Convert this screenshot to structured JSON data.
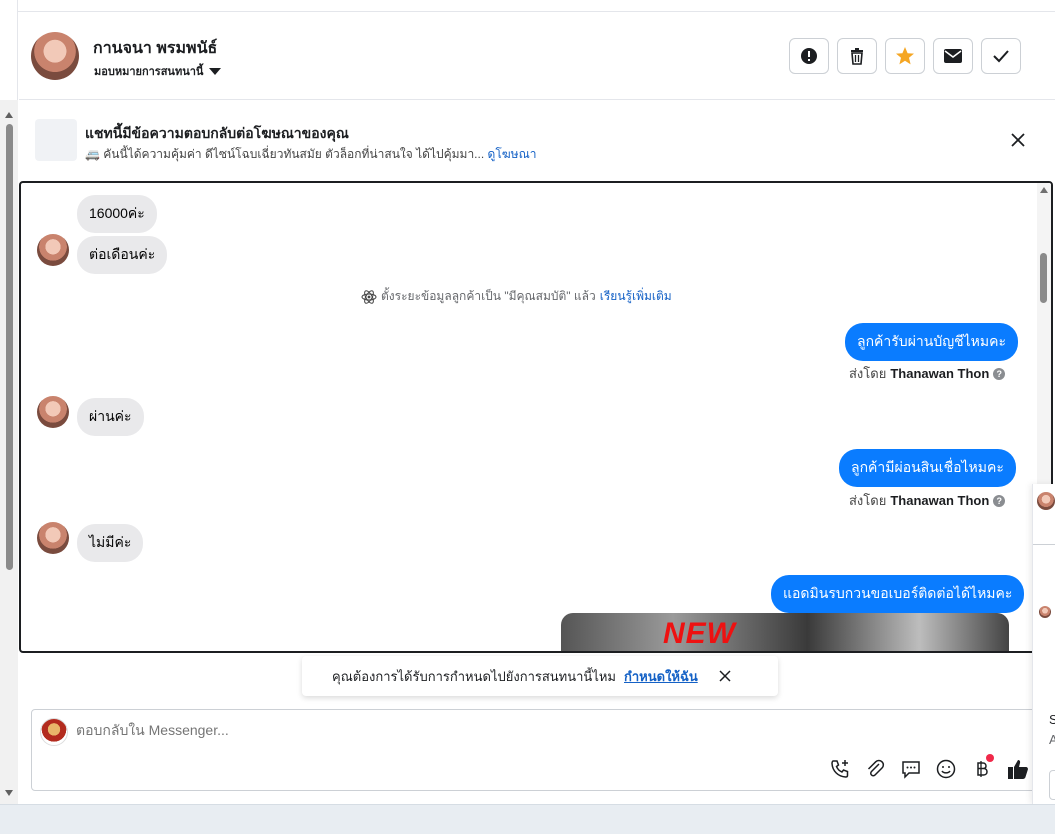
{
  "header": {
    "contact_name": "กานจนา พรมพนัธ์",
    "assign_label": "มอบหมายการสนทนานี้",
    "actions": [
      "spam-button",
      "delete-button",
      "star-button",
      "unread-button",
      "done-button"
    ]
  },
  "ad_banner": {
    "title": "แชทนี้มีข้อความตอบกลับต่อโฆษณาของคุณ",
    "text": "🚐 คันนี้ได้ความคุ้มค่า ดีไซน์โฉบเฉี่ยวทันสมัย ตัวล็อกที่น่าสนใจ ได้ไปคุ้มมา...",
    "link": "ดูโฆษณา"
  },
  "messages": {
    "m1": "16000ค่ะ",
    "m2": "ต่อเดือนค่ะ",
    "system_note": "ตั้งระยะข้อมูลลูกค้าเป็น \"มีคุณสมบัติ\" แล้ว",
    "system_link": "เรียนรู้เพิ่มเติม",
    "out1": "ลูกค้ารับผ่านบัญชีไหมคะ",
    "sent_by_prefix": "ส่งโดย",
    "sent_by_name": "Thanawan Thon",
    "in3": "ผ่านค่ะ",
    "out2": "ลูกค้ามีผ่อนสินเชื่อไหมคะ",
    "in4": "ไม่มีค่ะ",
    "out3": "แอดมินรบกวนขอเบอร์ติดต่อได้ไหมคะ",
    "image_text": "NEW"
  },
  "toast": {
    "text": "คุณต้องการได้รับการกำหนดไปยังการสนทนานี้ไหม",
    "link": "กำหนดให้ฉัน"
  },
  "composer": {
    "placeholder": "ตอบกลับใน Messenger..."
  },
  "right_panel": {
    "text_s": "S",
    "text_a": "A"
  },
  "colors": {
    "brand_blue": "#0a7cff",
    "link_blue": "#1461c6",
    "star_orange": "#f5a623",
    "notification_red": "#f02849"
  }
}
